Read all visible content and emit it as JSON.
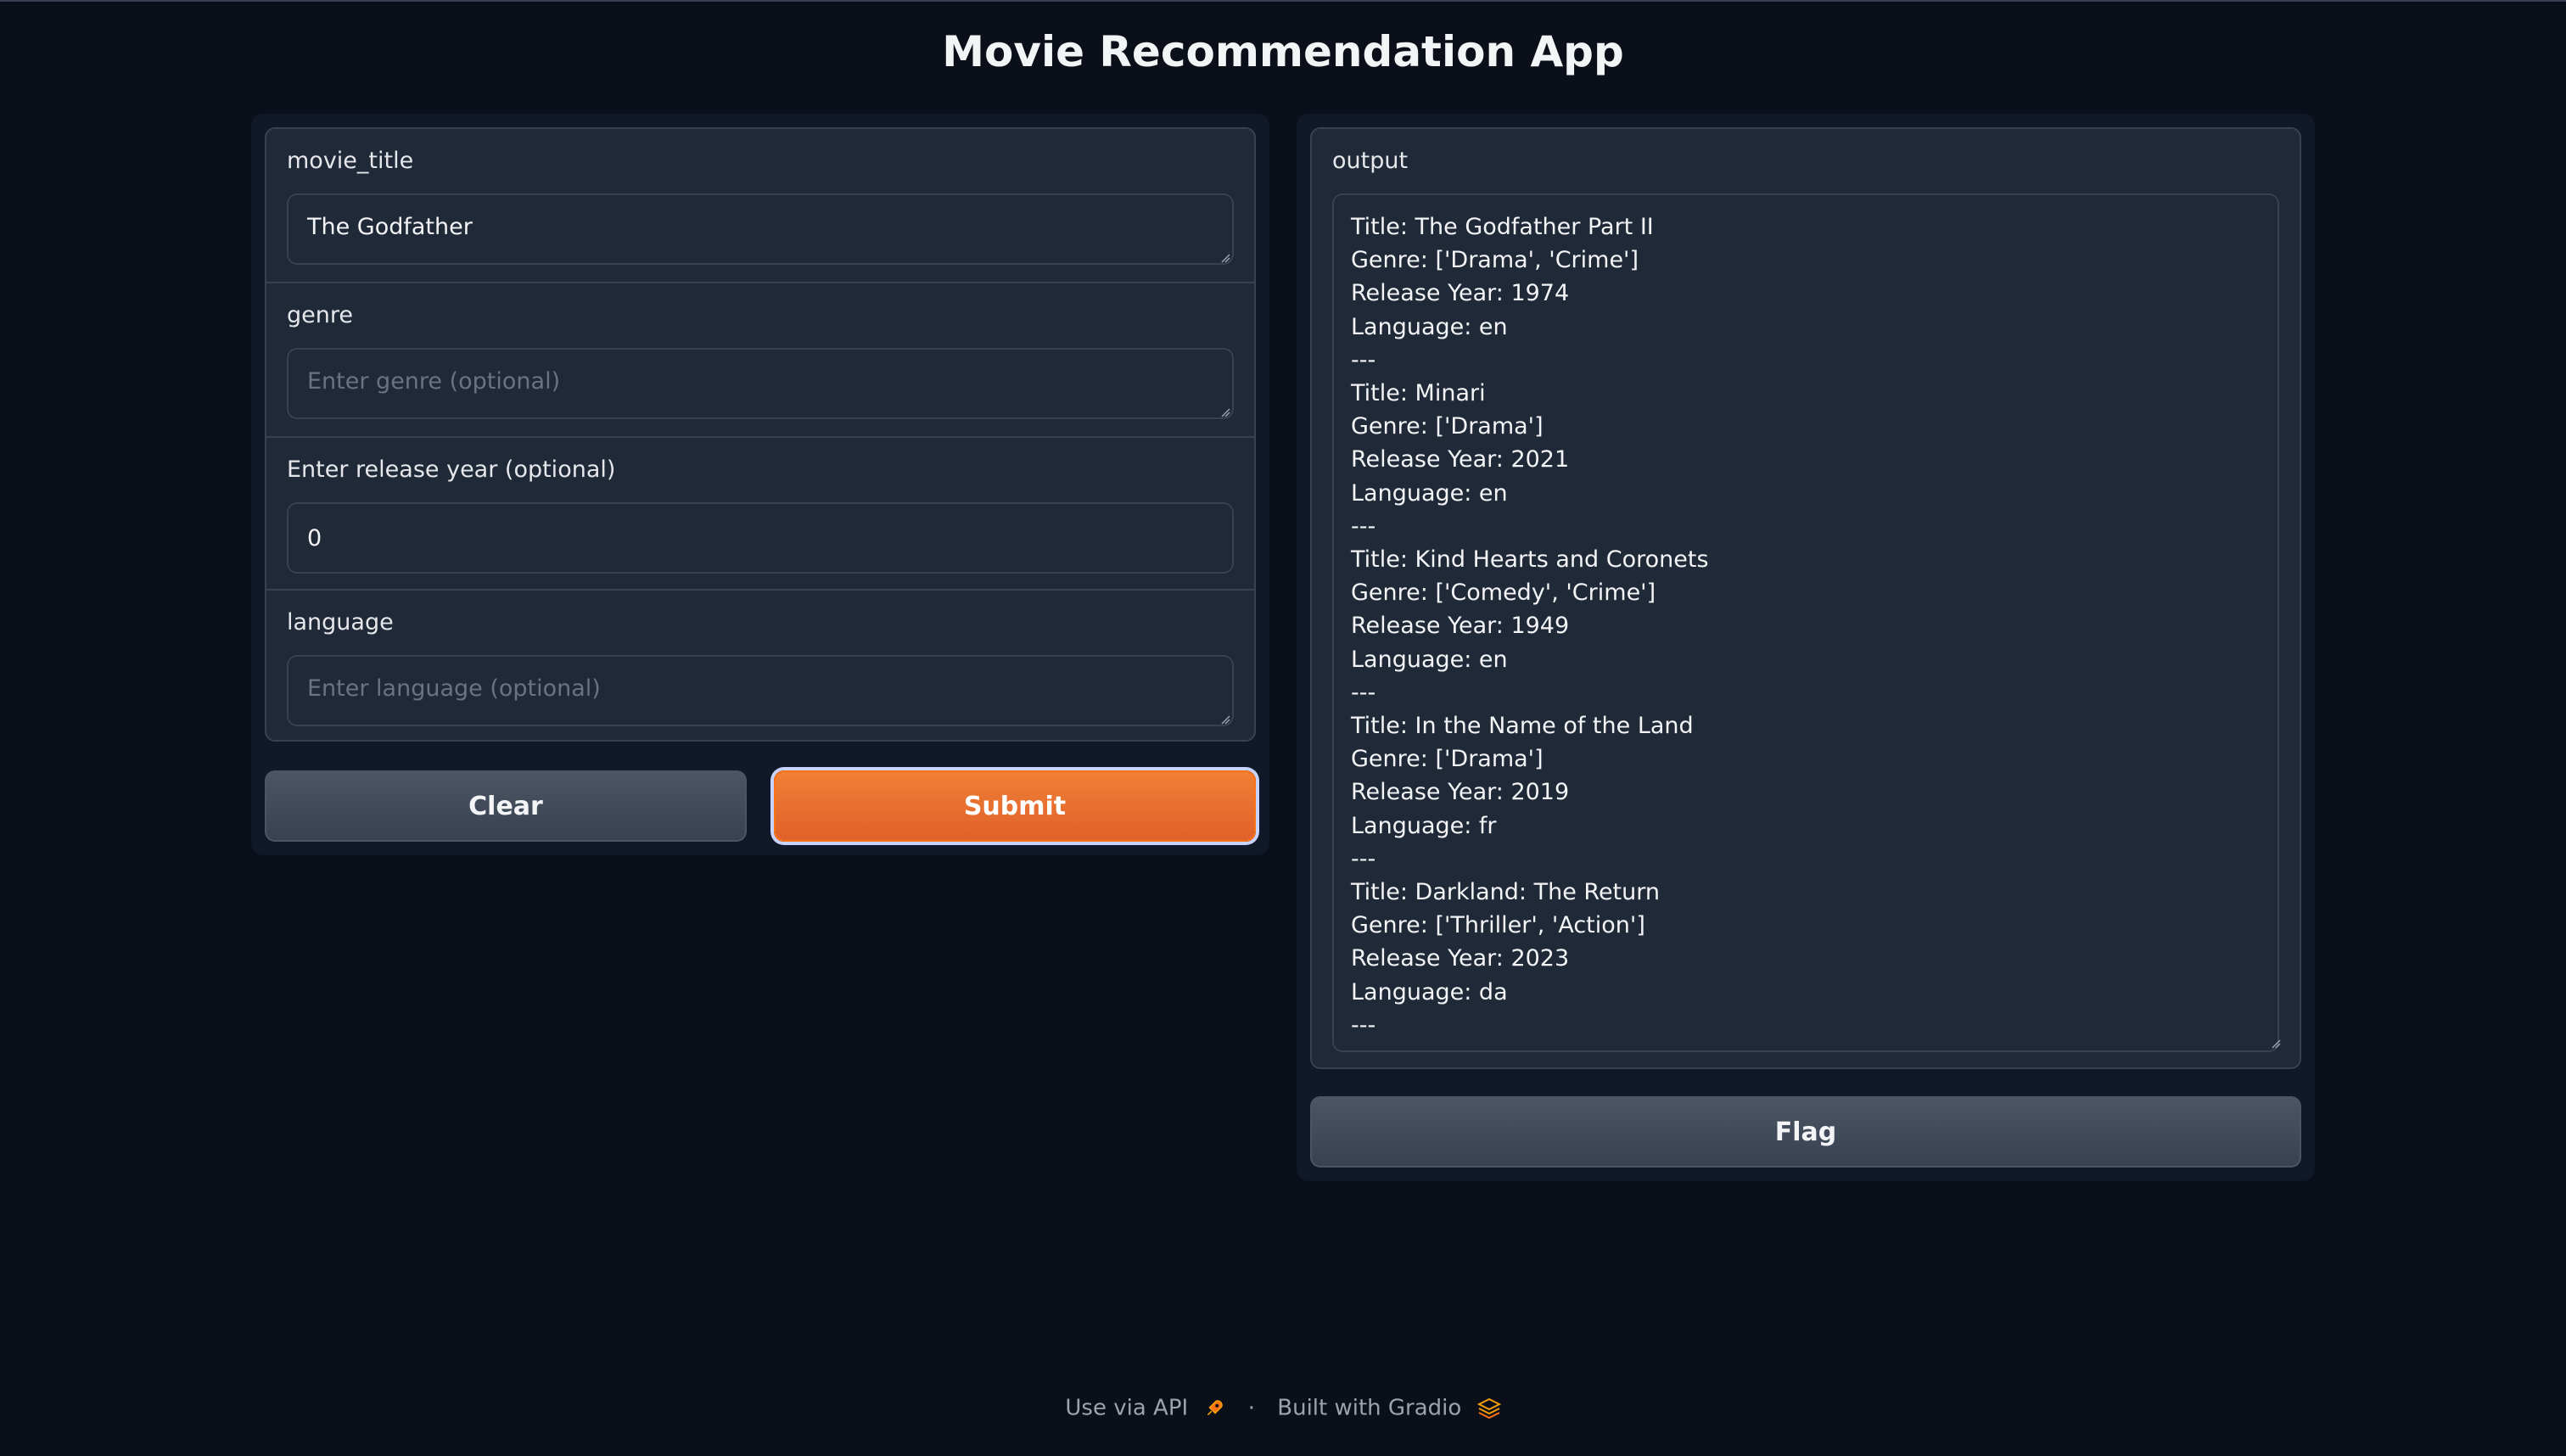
{
  "app": {
    "title": "Movie Recommendation App"
  },
  "inputs": {
    "movie_title": {
      "label": "movie_title",
      "value": "The Godfather",
      "placeholder": ""
    },
    "genre": {
      "label": "genre",
      "value": "",
      "placeholder": "Enter genre (optional)"
    },
    "release_year": {
      "label": "Enter release year (optional)",
      "value": "0"
    },
    "language": {
      "label": "language",
      "value": "",
      "placeholder": "Enter language (optional)"
    }
  },
  "buttons": {
    "clear": "Clear",
    "submit": "Submit",
    "flag": "Flag"
  },
  "output": {
    "label": "output",
    "lines": [
      "Title: The Godfather Part II",
      "Genre: ['Drama', 'Crime']",
      "Release Year: 1974",
      "Language: en",
      "---",
      "Title: Minari",
      "Genre: ['Drama']",
      "Release Year: 2021",
      "Language: en",
      "---",
      "Title: Kind Hearts and Coronets",
      "Genre: ['Comedy', 'Crime']",
      "Release Year: 1949",
      "Language: en",
      "---",
      "Title: In the Name of the Land",
      "Genre: ['Drama']",
      "Release Year: 2019",
      "Language: fr",
      "---",
      "Title: Darkland: The Return",
      "Genre: ['Thriller', 'Action']",
      "Release Year: 2023",
      "Language: da",
      "---"
    ]
  },
  "footer": {
    "api_link": "Use via API",
    "separator": "·",
    "built_with": "Built with Gradio"
  },
  "colors": {
    "background": "#0b0f19",
    "panel": "#111827",
    "block": "#1f2937",
    "border": "#374151",
    "primary": "#e0612a"
  },
  "icons": {
    "api": "rocket-icon",
    "gradio": "gradio-logo-icon"
  }
}
